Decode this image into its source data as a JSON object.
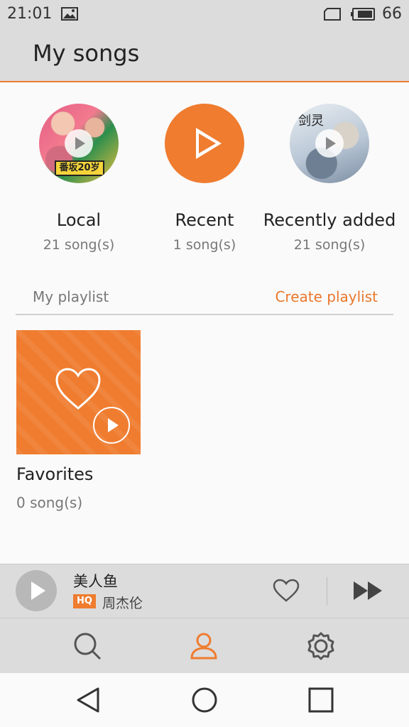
{
  "status_bar": {
    "time": "21:01",
    "battery": "66"
  },
  "header": {
    "title": "My songs"
  },
  "categories": [
    {
      "name": "Local",
      "count": "21 song(s)",
      "cover_text": "番坂20岁"
    },
    {
      "name": "Recent",
      "count": "1 song(s)"
    },
    {
      "name": "Recently added",
      "count": "21 song(s)",
      "cover_text": "剑灵"
    }
  ],
  "playlist": {
    "title": "My playlist",
    "create_label": "Create playlist",
    "items": [
      {
        "name": "Favorites",
        "count": "0 song(s)"
      }
    ]
  },
  "mini_player": {
    "title": "美人鱼",
    "quality": "HQ",
    "artist": "周杰伦"
  },
  "colors": {
    "accent": "#ef7c2f",
    "bar_bg": "#dcdcdc",
    "page_bg": "#fafafa"
  },
  "icons": {
    "nav": [
      "search-icon",
      "person-icon",
      "gear-icon"
    ],
    "system": [
      "back-icon",
      "home-icon",
      "recents-icon"
    ]
  }
}
